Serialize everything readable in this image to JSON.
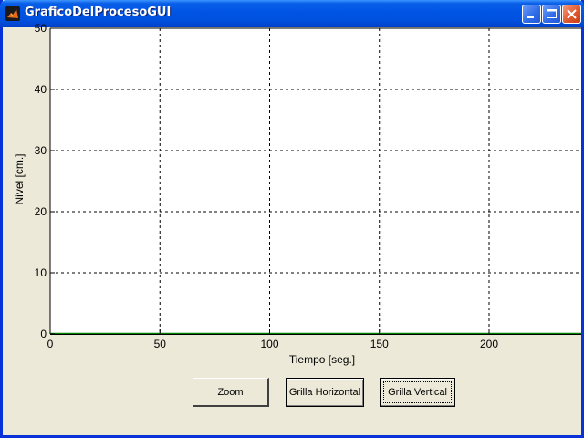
{
  "window": {
    "title": "GraficoDelProcesoGUI",
    "icon": "matlab-icon",
    "controls": [
      "minimize-icon",
      "maximize-icon",
      "close-icon"
    ]
  },
  "buttons": {
    "zoom": "Zoom",
    "grid_horizontal": "Grilla Horizontal",
    "grid_vertical": "Grilla Vertical"
  },
  "colors": {
    "title_bar": "#0054e3",
    "face": "#ece9d8",
    "plot_bg": "#ffffff",
    "grid": "#000000",
    "baseline_line": "#008000"
  },
  "chart_data": {
    "type": "line",
    "title": "",
    "xlabel": "Tiempo [seg.]",
    "ylabel": "Nivel [cm.]",
    "xlim": [
      0,
      242
    ],
    "ylim": [
      0,
      50
    ],
    "x_ticks": [
      0,
      50,
      100,
      150,
      200
    ],
    "x_tick_labels": [
      "0",
      "50",
      "100",
      "150",
      "200"
    ],
    "y_ticks": [
      0,
      10,
      20,
      30,
      40,
      50
    ],
    "y_tick_labels": [
      "0",
      "10",
      "20",
      "30",
      "40",
      "50"
    ],
    "grid": true,
    "grid_style": "dashed",
    "series": [
      {
        "color": "#008000",
        "x": [
          0,
          242
        ],
        "y": [
          0,
          0
        ]
      }
    ]
  }
}
